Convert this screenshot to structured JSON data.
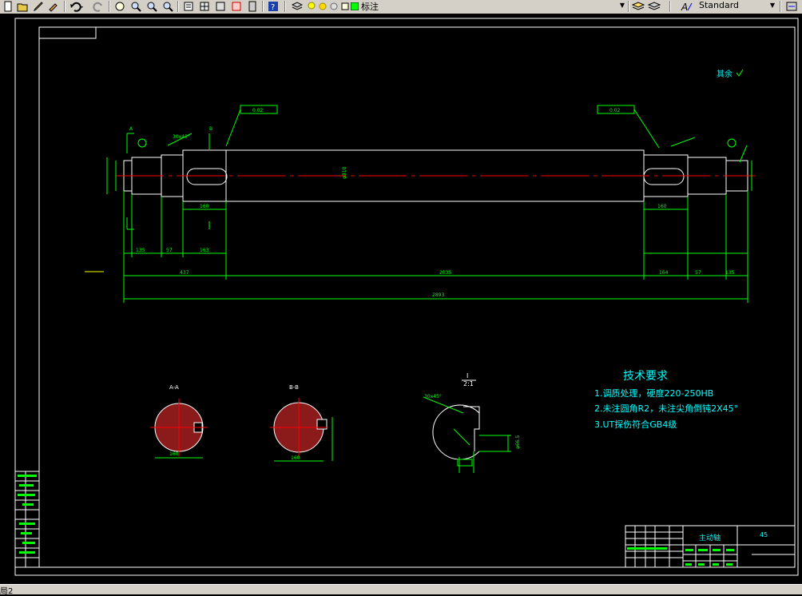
{
  "toolbar": {
    "layer_name": "标注",
    "text_style": "Standard"
  },
  "drawing": {
    "surface_label": "其余",
    "section_a_label": "A-A",
    "section_b_label": "B-B",
    "detail_label": "I",
    "detail_scale": "2:1",
    "tech_title": "技术要求",
    "tech_items": [
      "1.调质处理，硬度220-250HB",
      "2.未注圆角R2，未注尖角倒钝2X45°",
      "3.UT探伤符合GB4级"
    ],
    "part_name": "主动轴",
    "material": "45",
    "tolerance_left": "0.02",
    "tolerance_right": "0.02",
    "overall_length": "2893",
    "middle_length": "2035",
    "dim_left": "437",
    "dim_right_a": "164",
    "dim_right_b": "57",
    "dim_right_c": "135",
    "dim_left_a": "135",
    "dim_left_b": "57",
    "dim_left_c": "163",
    "dia_main": "φ310",
    "key_left": "160",
    "key_right": "160",
    "datum_a": "A",
    "datum_b": "B",
    "sec_a_width": "160",
    "sec_b_width": "160",
    "chamfer_label": "30x45°",
    "detail_dim": "φ66.5"
  },
  "statusbar": {
    "text": "局2"
  },
  "colors": {
    "toolbar_bg": "#d4d0c8",
    "canvas_bg": "#000000",
    "dimension": "#00ff00",
    "text": "#00ffff",
    "outline": "#ffffff",
    "section_fill": "#8b1a1a",
    "centerline": "#ff0000"
  }
}
